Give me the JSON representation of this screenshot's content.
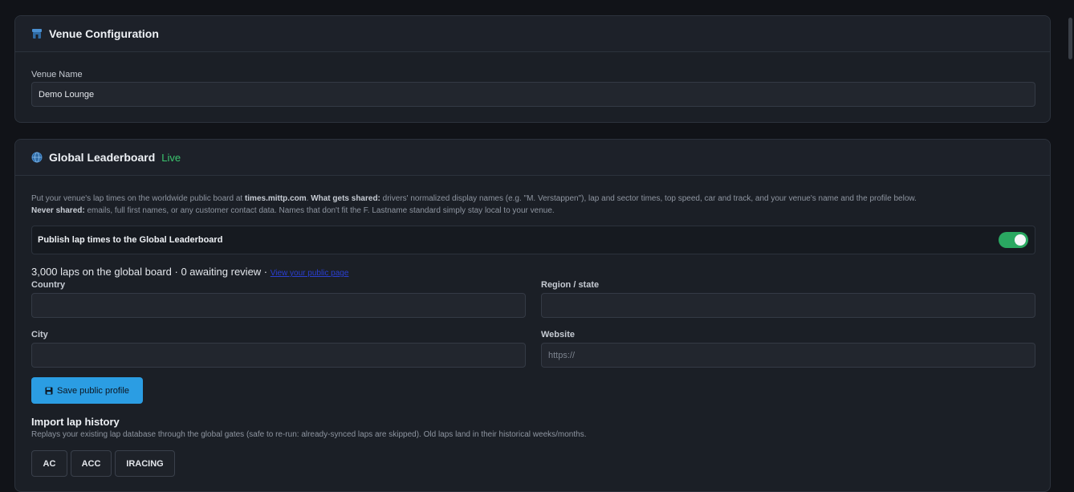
{
  "venue": {
    "title": "Venue Configuration",
    "icon": "store-icon",
    "name_label": "Venue Name",
    "name_value": "Demo Lounge"
  },
  "leaderboard": {
    "title": "Global Leaderboard",
    "status": "Live",
    "icon": "globe-icon",
    "desc1_a": "Put your venue's lap times on the worldwide public board at ",
    "desc1_site": "times.mittp.com",
    "desc1_b": ". ",
    "desc1_shared_label": "What gets shared:",
    "desc1_c": " drivers' normalized display names (e.g. \"M. Verstappen\"), lap and sector times, top speed, car and track, and your venue's name and the profile below.",
    "desc2_never_label": "Never shared:",
    "desc2_c": " emails, full first names, or any customer contact data. Names that don't fit the F. Lastname standard simply stay local to your venue.",
    "publish_label": "Publish lap times to the Global Leaderboard",
    "publish_enabled": true,
    "stats_text": "3,000 laps on the global board · 0 awaiting review · ",
    "stats_link": "View your public page",
    "country_label": "Country",
    "country_value": "",
    "region_label": "Region / state",
    "region_value": "",
    "city_label": "City",
    "city_value": "",
    "website_label": "Website",
    "website_placeholder": "https://",
    "save_label": "Save public profile",
    "import_title": "Import lap history",
    "import_desc": "Replays your existing lap database through the global gates (safe to re-run: already-synced laps are skipped). Old laps land in their historical weeks/months.",
    "sims": [
      "AC",
      "ACC",
      "IRACING"
    ]
  },
  "colors": {
    "accent": "#2b9de3",
    "live": "#3bc66f",
    "toggle_on": "#2aa861"
  }
}
